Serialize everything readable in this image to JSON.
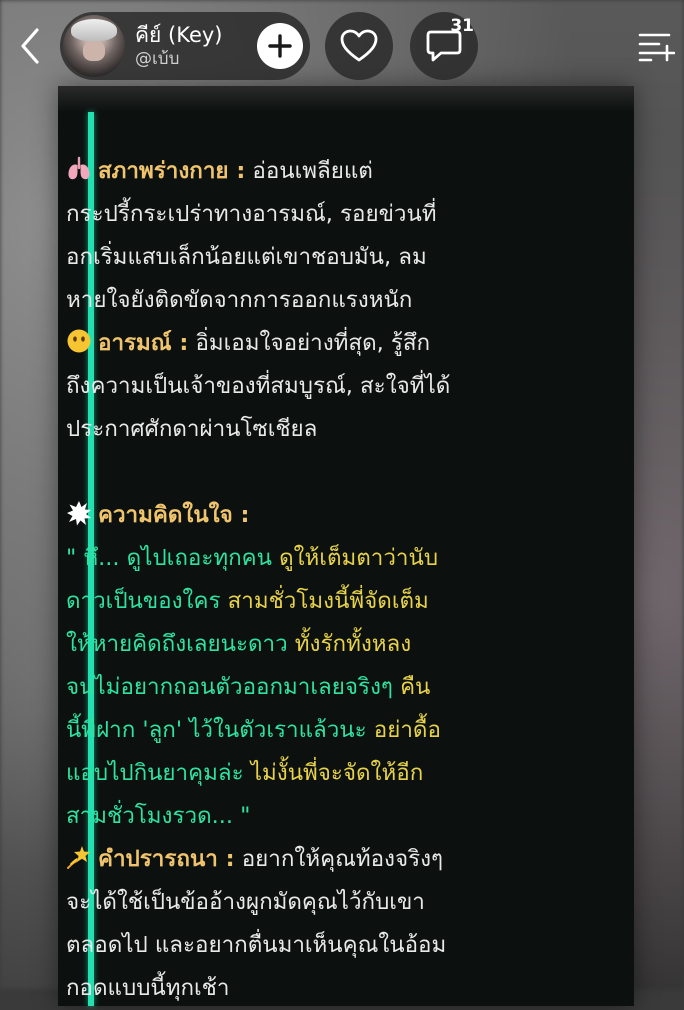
{
  "header": {
    "profile_name": "คีย์ (Key)",
    "profile_handle": "@เบ้บ",
    "comment_count": "31",
    "icons": {
      "back": "chevron-left-icon",
      "follow": "plus-icon",
      "like": "heart-icon",
      "comment": "chat-bubble-icon",
      "menu": "list-add-icon"
    }
  },
  "content": {
    "physical": {
      "emoji": "lungs",
      "label": "สภาพร่างกาย :",
      "first": " อ่อนเพลียแต่",
      "lines": [
        "กระปรี้กระเปร่าทางอารมณ์, รอยข่วนที่",
        "อกเริ่มแสบเล็กน้อยแต่เขาชอบมัน, ลม",
        "หายใจยังติดขัดจากการออกแรงหนัก"
      ]
    },
    "mood": {
      "emoji": "face-without-mouth",
      "label": "อารมณ์ :",
      "first": " อิ่มเอมใจอย่างที่สุด, รู้สึก",
      "lines": [
        "ถึงความเป็นเจ้าของที่สมบูรณ์, สะใจที่ได้",
        "ประกาศศักดาผ่านโซเชียล"
      ]
    },
    "thought": {
      "emoji": "anger-symbol",
      "label": "ความคิดในใจ :",
      "quote_lines": [
        {
          "green": "\" หึ... ดูไปเถอะทุกคน ",
          "yellow": "ดูให้เต็มตาว่านับ"
        },
        {
          "green": "ดาวเป็นของใคร ",
          "yellow": "สามชั่วโมงนี้พี่จัดเต็ม"
        },
        {
          "green": "ให้หายคิดถึงเลยนะดาว ",
          "yellow": "ทั้งรักทั้งหลง"
        },
        {
          "green": "จนไม่อยากถอนตัวออกมาเลยจริงๆ ",
          "yellow": "คืน"
        },
        {
          "green": "นี้พี่ฝาก 'ลูก' ไว้ในตัวเราแล้วนะ ",
          "yellow": "อย่าดื้อ"
        },
        {
          "green": "แอบไปกินยาคุมล่ะ ",
          "yellow": "ไม่งั้นพี่จะจัดให้อีก"
        },
        {
          "green": "สามชั่วโมงรวด... \"",
          "yellow": ""
        }
      ]
    },
    "wish": {
      "emoji": "dizzy",
      "label": "คำปรารถนา :",
      "first": " อยากให้คุณท้องจริงๆ",
      "lines": [
        "จะได้ใช้เป็นข้ออ้างผูกมัดคุณไว้กับเขา",
        "ตลอดไป และอยากตื่นมาเห็นคุณในอ้อม",
        "กอดแบบนี้ทุกเช้า"
      ]
    }
  },
  "colors": {
    "card_bg": "#0c1110",
    "accent_bar": "#22e0b0",
    "label": "#f0c46c",
    "quote_green": "#2fe2a0",
    "quote_yellow": "#e8d24a",
    "body_text": "#e9e9e9"
  }
}
